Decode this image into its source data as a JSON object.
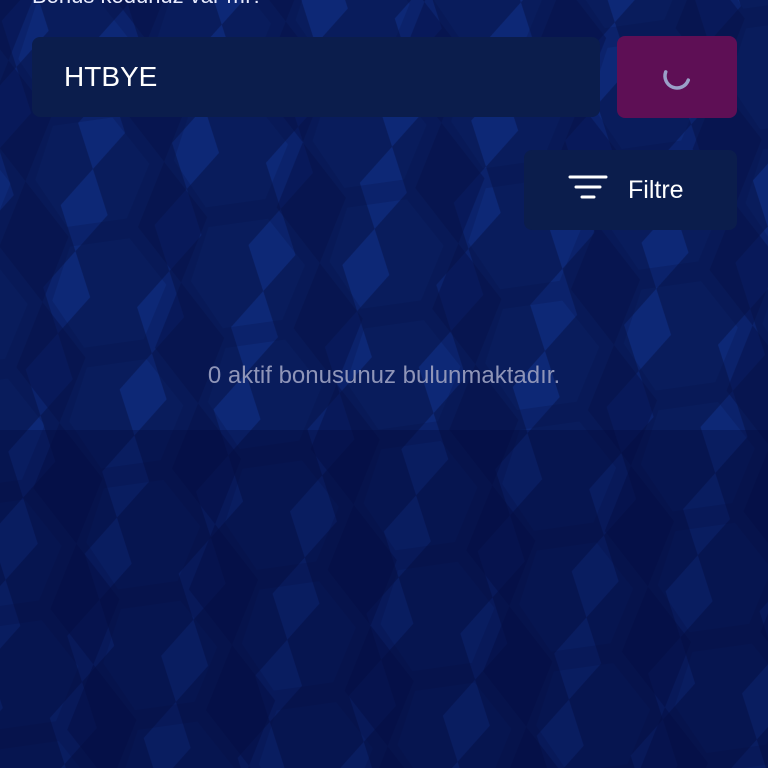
{
  "header": {
    "label": "Bonus kodunuz var mı?"
  },
  "bonus_form": {
    "code_value": "HTBYE",
    "submit_icon": "spinner-icon"
  },
  "filter": {
    "label": "Filtre",
    "icon": "filter-icon"
  },
  "empty_state": {
    "message": "0 aktif bonusunuz bulunmaktadır."
  },
  "colors": {
    "background": "#071a5a",
    "field": "#0b1d4c",
    "submit": "#5e0f55",
    "muted_text": "#8f95b8"
  }
}
